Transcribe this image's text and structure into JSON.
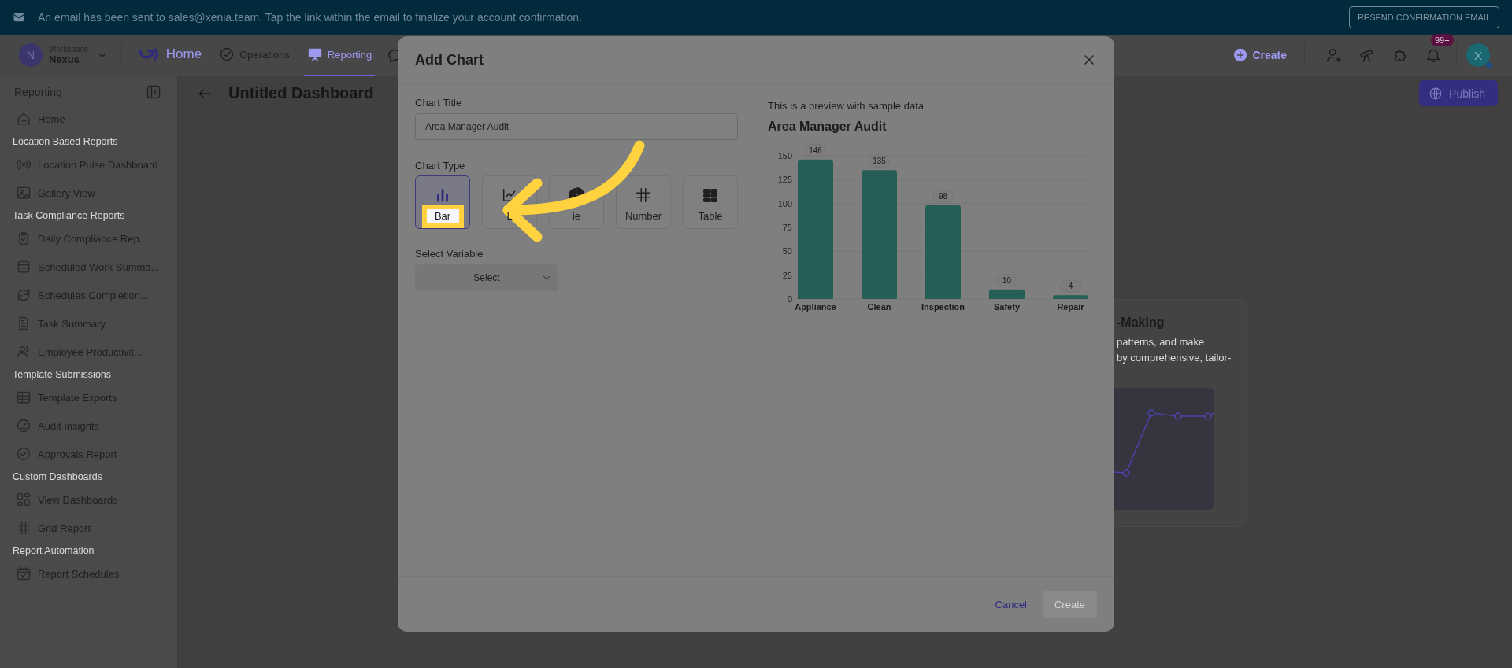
{
  "banner": {
    "message": "An email has been sent to sales@xenia.team. Tap the link within the email to finalize your account confirmation.",
    "button": "RESEND CONFIRMATION EMAIL"
  },
  "nav": {
    "workspace_avatar": "N",
    "workspace_label": "Workspace",
    "workspace_name": "Nexus",
    "tabs": [
      {
        "label": "Home",
        "kind": "brand",
        "selected": false
      },
      {
        "label": "Operations",
        "kind": "plain",
        "selected": false
      },
      {
        "label": "Reporting",
        "kind": "plain",
        "selected": true
      }
    ],
    "create": "Create",
    "notification_badge": "99+",
    "user_initial": "X"
  },
  "sidebar": {
    "title": "Reporting",
    "home": "Home",
    "sections": [
      {
        "heading": "Location Based Reports",
        "items": [
          "Location Pulse Dashboard",
          "Gallery View"
        ]
      },
      {
        "heading": "Task Compliance Reports",
        "items": [
          "Daily Compliance Rep...",
          "Scheduled Work Summa...",
          "Schedules Completion...",
          "Task Summary",
          "Employee Productivit..."
        ]
      },
      {
        "heading": "Template Submissions",
        "items": [
          "Template Exports",
          "Audit Insights",
          "Approvals Report"
        ]
      },
      {
        "heading": "Custom Dashboards",
        "items": [
          "View Dashboards",
          "Grid Report"
        ]
      },
      {
        "heading": "Report Automation",
        "items": [
          "Report Schedules"
        ]
      }
    ]
  },
  "page": {
    "title": "Untitled Dashboard",
    "publish": "Publish"
  },
  "background_card": {
    "title": "-Making",
    "lines": [
      "patterns, and make",
      "by comprehensive, tailor-"
    ]
  },
  "modal": {
    "title": "Add Chart",
    "chart_title_label": "Chart Title",
    "chart_title_value": "Area Manager Audit",
    "chart_type_label": "Chart Type",
    "chart_types": [
      {
        "label": "Bar",
        "selected": true,
        "highlighted": true
      },
      {
        "label": "L",
        "selected": false,
        "highlighted": false
      },
      {
        "label": "ie",
        "selected": false,
        "highlighted": false
      },
      {
        "label": "Number",
        "selected": false,
        "highlighted": false
      },
      {
        "label": "Table",
        "selected": false,
        "highlighted": false
      }
    ],
    "variable_label": "Select Variable",
    "variable_placeholder": "Select",
    "preview_note": "This is a preview with sample data",
    "chart_data": {
      "type": "bar",
      "title": "Area Manager Audit",
      "categories": [
        "Appliance",
        "Clean",
        "Inspection",
        "Safety",
        "Repair"
      ],
      "values": [
        146,
        135,
        98,
        10,
        4
      ],
      "ylim": [
        0,
        150
      ],
      "yticks": [
        0,
        25,
        50,
        75,
        100,
        125,
        150
      ],
      "data_labels": true,
      "grid": true
    },
    "cancel": "Cancel",
    "create": "Create",
    "create_disabled": true
  }
}
